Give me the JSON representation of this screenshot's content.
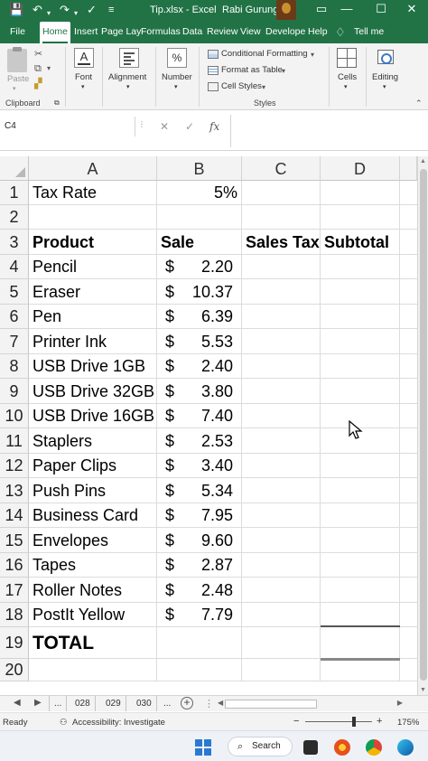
{
  "window": {
    "title": "Tip.xlsx  -  Excel",
    "user": "Rabi Gurung",
    "quick_access": {
      "save_icon": "💾",
      "undo_icon": "↶",
      "redo_icon": "↷",
      "spell_icon": "✓",
      "more_icon": "≡"
    },
    "minimize": "—",
    "restore": "☐",
    "close": "✕"
  },
  "tabs": [
    "File",
    "Home",
    "Insert",
    "Page Lay",
    "Formulas",
    "Data",
    "Review",
    "View",
    "Develope",
    "Help"
  ],
  "tell_me": "Tell me",
  "ribbon": {
    "clipboard": {
      "paste": "Paste",
      "group": "Clipboard"
    },
    "font": {
      "label": "Font"
    },
    "alignment": {
      "label": "Alignment"
    },
    "number": {
      "label": "Number",
      "icon": "%"
    },
    "styles": {
      "conditional": "Conditional Formatting",
      "table": "Format as Table",
      "cell_styles": "Cell Styles",
      "group": "Styles"
    },
    "cells": {
      "label": "Cells"
    },
    "editing": {
      "label": "Editing"
    }
  },
  "formula_bar": {
    "name_box": "C4",
    "cancel": "✕",
    "enter": "✓",
    "fx": "fx",
    "value": ""
  },
  "columns": [
    "A",
    "B",
    "C",
    "D"
  ],
  "rows": [
    {
      "n": "1",
      "a": "Tax Rate",
      "b_cur": "",
      "b": "5%",
      "c": "",
      "d": ""
    },
    {
      "n": "2",
      "a": "",
      "b_cur": "",
      "b": "",
      "c": "",
      "d": ""
    },
    {
      "n": "3",
      "a": "Product",
      "b_cur": "",
      "b": "Sale",
      "c": "Sales Tax",
      "d": "Subtotal"
    },
    {
      "n": "4",
      "a": "Pencil",
      "b_cur": "$",
      "b": "2.20",
      "c": "",
      "d": ""
    },
    {
      "n": "5",
      "a": "Eraser",
      "b_cur": "$",
      "b": "10.37",
      "c": "",
      "d": ""
    },
    {
      "n": "6",
      "a": "Pen",
      "b_cur": "$",
      "b": "6.39",
      "c": "",
      "d": ""
    },
    {
      "n": "7",
      "a": "Printer Ink",
      "b_cur": "$",
      "b": "5.53",
      "c": "",
      "d": ""
    },
    {
      "n": "8",
      "a": "USB Drive 1GB",
      "b_cur": "$",
      "b": "2.40",
      "c": "",
      "d": ""
    },
    {
      "n": "9",
      "a": "USB Drive 32GB",
      "b_cur": "$",
      "b": "3.80",
      "c": "",
      "d": ""
    },
    {
      "n": "10",
      "a": "USB Drive 16GB",
      "b_cur": "$",
      "b": "7.40",
      "c": "",
      "d": ""
    },
    {
      "n": "11",
      "a": "Staplers",
      "b_cur": "$",
      "b": "2.53",
      "c": "",
      "d": ""
    },
    {
      "n": "12",
      "a": "Paper Clips",
      "b_cur": "$",
      "b": "3.40",
      "c": "",
      "d": ""
    },
    {
      "n": "13",
      "a": "Push Pins",
      "b_cur": "$",
      "b": "5.34",
      "c": "",
      "d": ""
    },
    {
      "n": "14",
      "a": "Business Card",
      "b_cur": "$",
      "b": "7.95",
      "c": "",
      "d": ""
    },
    {
      "n": "15",
      "a": "Envelopes",
      "b_cur": "$",
      "b": "9.60",
      "c": "",
      "d": ""
    },
    {
      "n": "16",
      "a": "Tapes",
      "b_cur": "$",
      "b": "2.87",
      "c": "",
      "d": ""
    },
    {
      "n": "17",
      "a": "Roller Notes",
      "b_cur": "$",
      "b": "2.48",
      "c": "",
      "d": ""
    },
    {
      "n": "18",
      "a": "PostIt Yellow",
      "b_cur": "$",
      "b": "7.79",
      "c": "",
      "d": ""
    },
    {
      "n": "19",
      "a": "TOTAL",
      "b_cur": "",
      "b": "",
      "c": "",
      "d": ""
    },
    {
      "n": "20",
      "a": "",
      "b_cur": "",
      "b": "",
      "c": "",
      "d": ""
    }
  ],
  "sheets": {
    "first_nav": "◀",
    "next_nav": "▶",
    "ellipsis": "...",
    "tabs": [
      "028",
      "029",
      "030"
    ],
    "more": "...",
    "add": "+"
  },
  "status_bar": {
    "ready": "Ready",
    "accessibility": "Accessibility: Investigate",
    "zoom_minus": "−",
    "zoom_plus": "+",
    "zoom": "175%"
  },
  "taskbar": {
    "search": "Search",
    "search_icon": "⌕"
  },
  "colors": {
    "excel_green": "#217346",
    "ribbon_bg": "#f3f3f3"
  }
}
